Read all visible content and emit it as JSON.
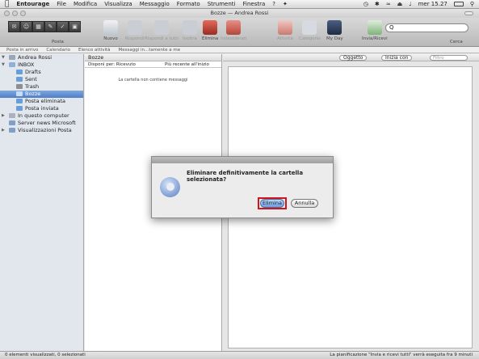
{
  "menubar": {
    "apple": "",
    "app": "Entourage",
    "items": [
      "File",
      "Modifica",
      "Visualizza",
      "Messaggio",
      "Formato",
      "Strumenti",
      "Finestra",
      "?"
    ],
    "clock": "mer 15.27"
  },
  "window": {
    "title": "Bozze — Andrea Rossi"
  },
  "toolbar": {
    "posta_label": "Posta",
    "nuovo_label": "Nuovo",
    "rispondi_label": "Rispondi",
    "rispondi_tutti_label": "Rispondi a tutti",
    "inoltra_label": "Inoltra",
    "elimina_label": "Elimina",
    "indesiderati_label": "Indesiderati",
    "attivita_label": "Attività",
    "categorie_label": "Categorie",
    "myday_label": "My Day",
    "invia_label": "Invia/Ricevi",
    "search_label": "Cerca",
    "search_value": "Q"
  },
  "viewbar": {
    "items": [
      "Posta in arrivo",
      "Calendario",
      "Elenco attività",
      "Messaggi in...tamente a me"
    ]
  },
  "sidebar": {
    "items": [
      {
        "label": "Andrea Rossi",
        "indent": 0,
        "expanded": true
      },
      {
        "label": "INBOX",
        "indent": 0,
        "expanded": true
      },
      {
        "label": "Drafts",
        "indent": 1
      },
      {
        "label": "Sent",
        "indent": 1
      },
      {
        "label": "Trash",
        "indent": 1
      },
      {
        "label": "Bozze",
        "indent": 1,
        "selected": true
      },
      {
        "label": "Posta eliminata",
        "indent": 1
      },
      {
        "label": "Posta inviata",
        "indent": 1
      },
      {
        "label": "In questo computer",
        "indent": 0,
        "expanded": false
      },
      {
        "label": "Server news Microsoft",
        "indent": 0
      },
      {
        "label": "Visualizzazioni Posta",
        "indent": 0,
        "expanded": false
      }
    ]
  },
  "list": {
    "title": "Bozze",
    "sort_by": "Disponi per: Ricevuto",
    "sort_order": "Più recente all'inizio",
    "empty_message": "La cartella non contiene messaggi"
  },
  "reader": {
    "filter_field": "Oggetto",
    "filter_mode": "Inizia con",
    "filter_placeholder": "Filtro"
  },
  "status": {
    "left": "0 elementi visualizzati, 0 selezionati",
    "right": "La pianificazione \"Invia e ricevi tutti\" verrà eseguita fra 9 minuti"
  },
  "dialog": {
    "message": "Eliminare definitivamente la cartella selezionata?",
    "confirm_label": "Elimina",
    "cancel_label": "Annulla"
  },
  "colors": {
    "highlight": "#d0151b",
    "selection": "#5b89cc"
  }
}
